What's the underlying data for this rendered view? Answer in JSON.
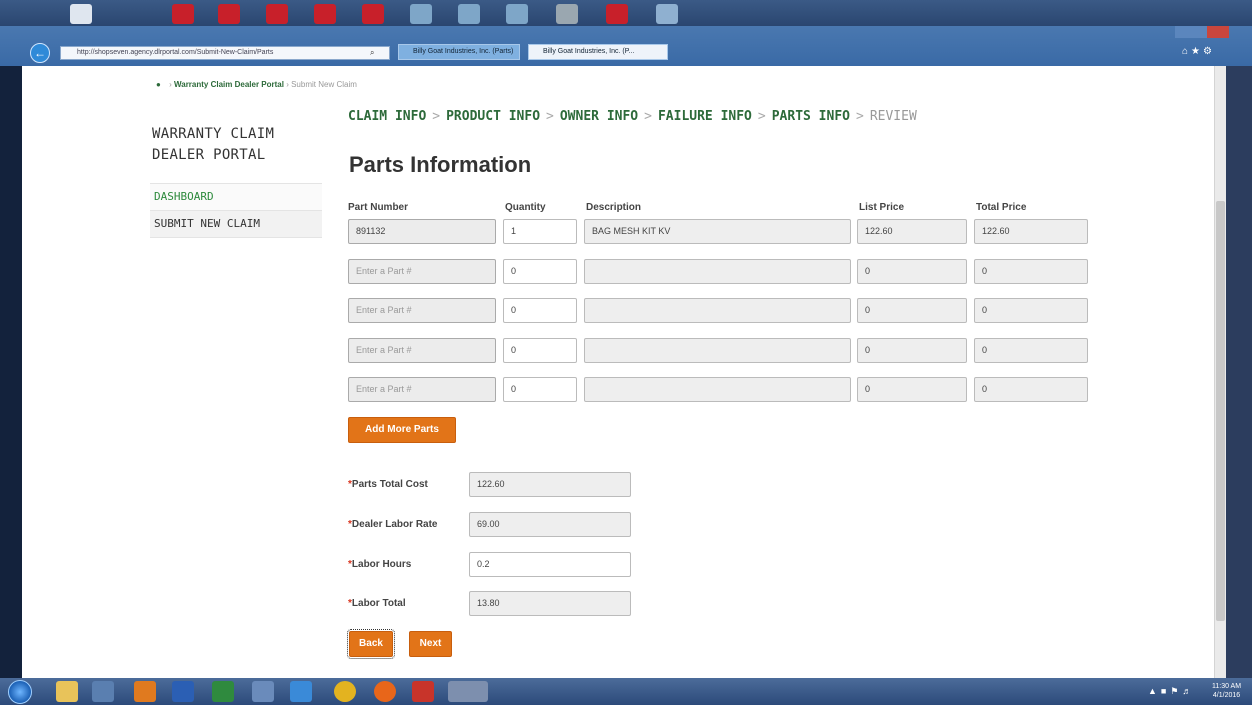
{
  "browser": {
    "address": "http://shopseven.agency.dlrportal.com/Submit-New-Claim/Parts",
    "tabs": [
      {
        "label": "Billy Goat Industries, Inc. (Parts)"
      },
      {
        "label": "Billy Goat Industries, Inc. (P..."
      }
    ]
  },
  "breadcrumb": {
    "root": "Warranty Claim Dealer Portal",
    "separator": "›",
    "current": "Submit New Claim"
  },
  "sidebar": {
    "title_line1": "WARRANTY CLAIM",
    "title_line2": "DEALER PORTAL",
    "items": [
      {
        "label": "DASHBOARD",
        "active": true
      },
      {
        "label": "SUBMIT NEW CLAIM",
        "active": false
      }
    ]
  },
  "steps": [
    {
      "label": "CLAIM INFO",
      "state": "done"
    },
    {
      "label": "PRODUCT INFO",
      "state": "done"
    },
    {
      "label": "OWNER INFO",
      "state": "done"
    },
    {
      "label": "FAILURE INFO",
      "state": "done"
    },
    {
      "label": "PARTS INFO",
      "state": "current"
    },
    {
      "label": "REVIEW",
      "state": "pending"
    }
  ],
  "steps_separator": ">",
  "page_heading": "Parts Information",
  "table": {
    "headers": {
      "part_number": "Part Number",
      "quantity": "Quantity",
      "description": "Description",
      "list_price": "List Price",
      "total_price": "Total Price"
    },
    "part_placeholder": "Enter a Part #",
    "rows": [
      {
        "part_number": "891132",
        "quantity": "1",
        "description": "BAG MESH KIT KV",
        "list_price": "122.60",
        "total_price": "122.60"
      },
      {
        "part_number": "",
        "quantity": "0",
        "description": "",
        "list_price": "0",
        "total_price": "0"
      },
      {
        "part_number": "",
        "quantity": "0",
        "description": "",
        "list_price": "0",
        "total_price": "0"
      },
      {
        "part_number": "",
        "quantity": "0",
        "description": "",
        "list_price": "0",
        "total_price": "0"
      },
      {
        "part_number": "",
        "quantity": "0",
        "description": "",
        "list_price": "0",
        "total_price": "0"
      }
    ]
  },
  "add_more_label": "Add More Parts",
  "summary": {
    "required_mark": "*",
    "parts_total_label": "Parts Total Cost",
    "parts_total_value": "122.60",
    "dealer_rate_label": "Dealer Labor Rate",
    "dealer_rate_value": "69.00",
    "labor_hours_label": "Labor Hours",
    "labor_hours_value": "0.2",
    "labor_total_label": "Labor Total",
    "labor_total_value": "13.80"
  },
  "buttons": {
    "back": "Back",
    "next": "Next"
  },
  "taskbar": {
    "time": "11:30 AM",
    "date": "4/1/2016"
  },
  "colors": {
    "accent_orange": "#e27418",
    "nav_green": "#2d6a3a",
    "active_green": "#2d8a3c"
  }
}
